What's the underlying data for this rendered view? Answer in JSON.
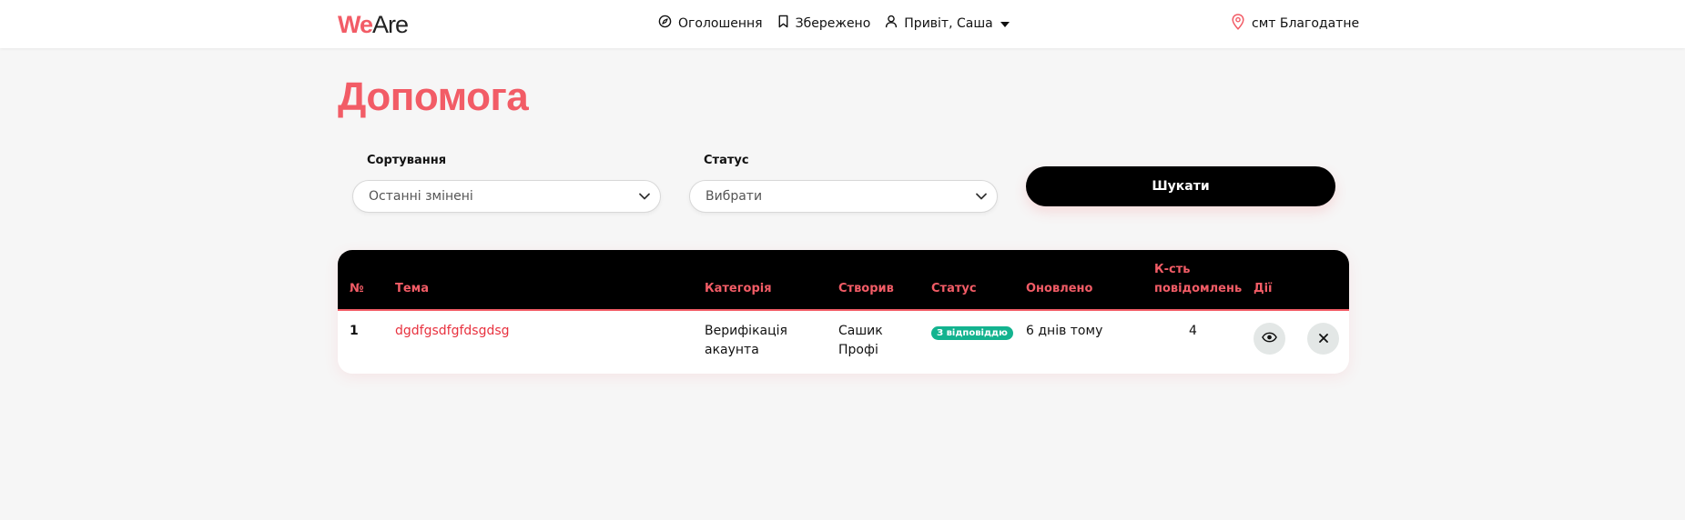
{
  "header": {
    "logo_primary": "We",
    "logo_secondary": "Are",
    "nav": {
      "ads_label": "Оголошення",
      "saved_label": "Збережено",
      "greeting_label": "Привіт, Саша"
    },
    "location_label": "смт Благодатне"
  },
  "page": {
    "title": "Допомога"
  },
  "filters": {
    "sort_label": "Сортування",
    "sort_value": "Останні змінені",
    "status_label": "Статус",
    "status_value": "Вибрати",
    "search_button": "Шукати"
  },
  "table": {
    "headers": {
      "num": "№",
      "topic": "Тема",
      "category": "Категорія",
      "author": "Створив",
      "status": "Статус",
      "updated": "Оновлено",
      "messages_line1": "К-сть",
      "messages_line2": "повідомлень",
      "actions": "Дії"
    },
    "rows": [
      {
        "num": "1",
        "topic": "dgdfgsdfgfdsgdsg",
        "category_line1": "Верифікація",
        "category_line2": "акаунта",
        "author_line1": "Сашик",
        "author_line2": "Профі",
        "status": "З відповіддю",
        "updated": "6 днів тому",
        "messages": "4"
      }
    ]
  },
  "colors": {
    "accent": "#f25c66",
    "link": "#e8323f",
    "status_badge": "#13b38f",
    "header_bg": "#000000",
    "page_bg": "#f6f6f6"
  },
  "icons": {
    "ads": "compass-icon",
    "saved": "bookmark-icon",
    "user": "user-icon",
    "greeting_caret": "caret-down-icon",
    "location": "map-pin-icon",
    "select_chevron": "chevron-down-icon",
    "view": "eye-icon",
    "delete": "close-icon"
  }
}
